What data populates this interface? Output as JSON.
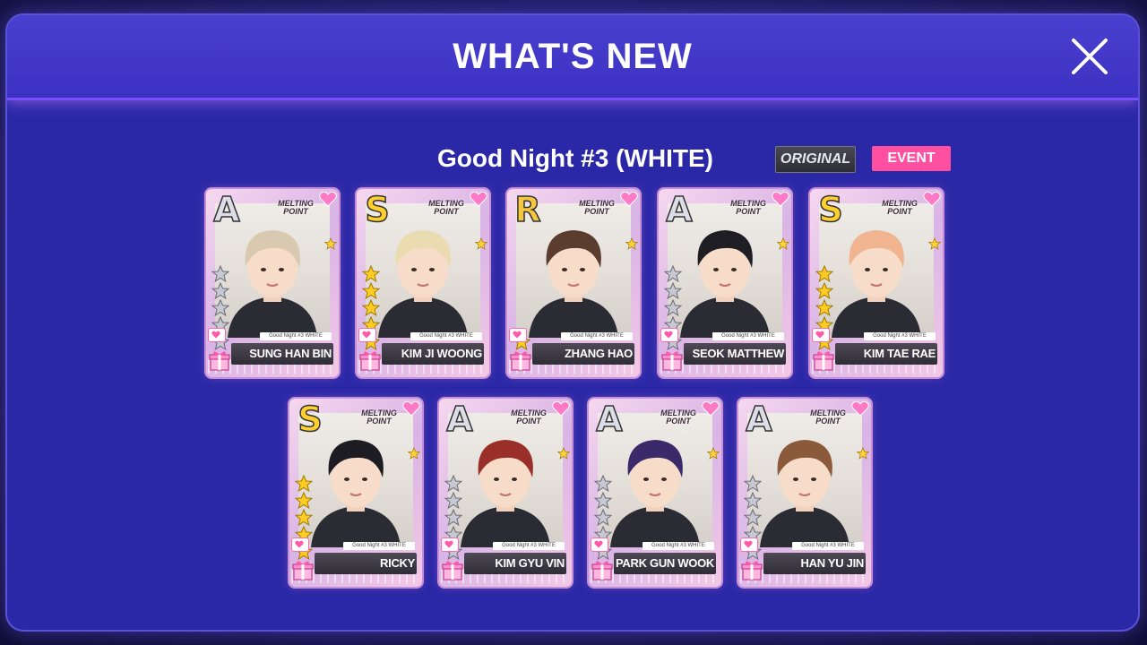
{
  "modal": {
    "title": "WHAT'S NEW",
    "close_icon": "close-icon"
  },
  "event": {
    "title": "Good Night #3 (WHITE)",
    "badges": {
      "original": "ORIGINAL",
      "event": "EVENT"
    }
  },
  "card_common": {
    "logo_text": "MELTING POINT",
    "set_label": "Good Night #3 WHITE"
  },
  "cards": [
    {
      "name": "SUNG HAN BIN",
      "rank": "A",
      "stars": 5,
      "star_color": "silver",
      "hair": "#d9c9b0"
    },
    {
      "name": "KIM JI WOONG",
      "rank": "S",
      "stars": 5,
      "star_color": "gold",
      "hair": "#eadcb0"
    },
    {
      "name": "ZHANG HAO",
      "rank": "R",
      "stars": 1,
      "star_color": "gold",
      "hair": "#5a3d2e"
    },
    {
      "name": "SEOK MATTHEW",
      "rank": "A",
      "stars": 5,
      "star_color": "silver",
      "hair": "#1e1e24"
    },
    {
      "name": "KIM TAE RAE",
      "rank": "S",
      "stars": 5,
      "star_color": "gold",
      "hair": "#f0b590"
    },
    {
      "name": "RICKY",
      "rank": "S",
      "stars": 5,
      "star_color": "gold",
      "hair": "#1c1c22"
    },
    {
      "name": "KIM GYU VIN",
      "rank": "A",
      "stars": 5,
      "star_color": "silver",
      "hair": "#9a2f2a"
    },
    {
      "name": "PARK GUN WOOK",
      "rank": "A",
      "stars": 5,
      "star_color": "silver",
      "hair": "#3a2a6a"
    },
    {
      "name": "HAN YU JIN",
      "rank": "A",
      "stars": 5,
      "star_color": "silver",
      "hair": "#8a5a3a"
    }
  ],
  "colors": {
    "event_badge": "#ff4fa0",
    "star_gold": "#ffcc22",
    "star_silver": "#c8c8d2"
  }
}
